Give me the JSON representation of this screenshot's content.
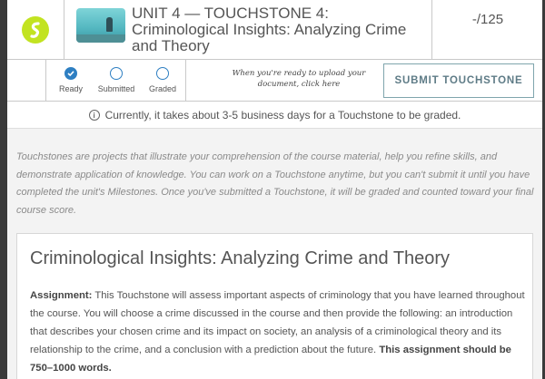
{
  "header": {
    "logo_icon": "sophia-swoosh-logo",
    "thumbnail_icon": "crime-scene-thumbnail",
    "title": "UNIT 4 — TOUCHSTONE 4: Criminological Insights: Analyzing Crime and Theory",
    "score": "-/125"
  },
  "status": {
    "steps": [
      {
        "label": "Ready",
        "state": "complete"
      },
      {
        "label": "Submitted",
        "state": "pending"
      },
      {
        "label": "Graded",
        "state": "pending"
      }
    ],
    "upload_note": "When you're ready to upload your document, click here",
    "submit_label": "SUBMIT TOUCHSTONE",
    "accent_color": "#2e7fc2"
  },
  "info": {
    "text": "Currently, it takes about 3-5 business days for a Touchstone to be graded."
  },
  "intro": {
    "text": "Touchstones are projects that illustrate your comprehension of the course material, help you refine skills, and demonstrate application of knowledge. You can work on a Touchstone anytime, but you can't submit it until you have completed the unit's Milestones. Once you've submitted a Touchstone, it will be graded and counted toward your final course score."
  },
  "assignment": {
    "heading": "Criminological Insights: Analyzing Crime and Theory",
    "label": "Assignment:",
    "body": " This Touchstone will assess important aspects of criminology that you have learned throughout the course. You will choose a crime discussed in the course and then provide the following: an introduction that describes your chosen crime and its impact on society, an analysis of a criminological theory and its relationship to the crime, and a conclusion with a prediction about the future. ",
    "word_requirement": "This assignment should be 750–1000 words."
  }
}
